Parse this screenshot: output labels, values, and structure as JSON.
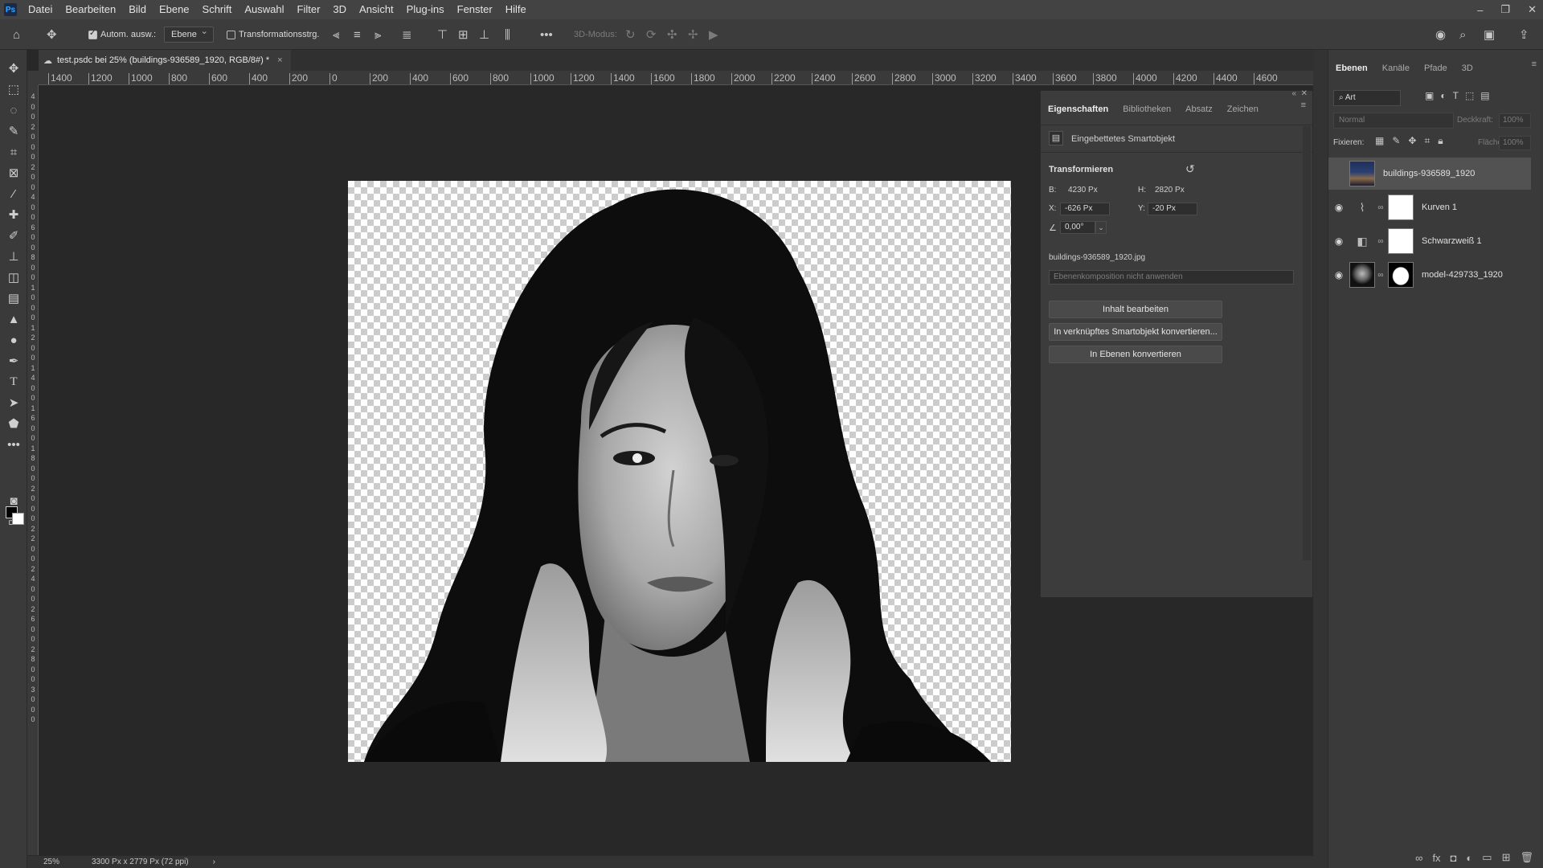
{
  "app": {
    "logo": "Ps"
  },
  "menu": [
    "Datei",
    "Bearbeiten",
    "Bild",
    "Ebene",
    "Schrift",
    "Auswahl",
    "Filter",
    "3D",
    "Ansicht",
    "Plug-ins",
    "Fenster",
    "Hilfe"
  ],
  "window_controls": {
    "minimize": "–",
    "restore": "❐",
    "close": "✕"
  },
  "options": {
    "auto_select_label": "Autom. ausw.:",
    "auto_select_value": "Ebene",
    "transform_label": "Transformationsstrg.",
    "mode_3d_label": "3D-Modus:"
  },
  "document_tab": {
    "title": "test.psdc bei 25% (buildings-936589_1920, RGB/8#) *",
    "close": "×"
  },
  "ruler_top": [
    "1400",
    "1200",
    "1000",
    "800",
    "600",
    "400",
    "200",
    "0",
    "200",
    "400",
    "600",
    "800",
    "1000",
    "1200",
    "1400",
    "1600",
    "1800",
    "2000",
    "2200",
    "2400",
    "2600",
    "2800",
    "3000",
    "3200",
    "3400",
    "3600",
    "3800",
    "4000",
    "4200",
    "4400",
    "4600"
  ],
  "ruler_left": [
    "4",
    "0",
    "0",
    "2",
    "0",
    "0",
    "0",
    "2",
    "0",
    "0",
    "4",
    "0",
    "0",
    "6",
    "0",
    "0",
    "8",
    "0",
    "0",
    "1",
    "0",
    "0",
    "0",
    "1",
    "2",
    "0",
    "0",
    "1",
    "4",
    "0",
    "0",
    "1",
    "6",
    "0",
    "0",
    "1",
    "8",
    "0",
    "0",
    "2",
    "0",
    "0",
    "0",
    "2",
    "2",
    "0",
    "0",
    "2",
    "4",
    "0",
    "0",
    "2",
    "6",
    "0",
    "0",
    "2",
    "8",
    "0",
    "0",
    "3",
    "0",
    "0",
    "0"
  ],
  "properties": {
    "tabs": [
      "Eigenschaften",
      "Bibliotheken",
      "Absatz",
      "Zeichen"
    ],
    "object_type": "Eingebettetes Smartobjekt",
    "section": "Transformieren",
    "b_label": "B:",
    "b_value": "4230 Px",
    "h_label": "H:",
    "h_value": "2820 Px",
    "x_label": "X:",
    "x_value": "-626 Px",
    "y_label": "Y:",
    "y_value": "-20 Px",
    "angle_value": "0,00°",
    "file_name": "buildings-936589_1920.jpg",
    "layer_comp_placeholder": "Ebenenkomposition nicht anwenden",
    "buttons": [
      "Inhalt bearbeiten",
      "In verknüpftes Smartobjekt konvertieren...",
      "In Ebenen konvertieren"
    ]
  },
  "layers_panel": {
    "tabs": [
      "Ebenen",
      "Kanäle",
      "Pfade",
      "3D"
    ],
    "filter_label": "Art",
    "blend_mode": "Normal",
    "opacity_label": "Deckkraft:",
    "opacity_value": "100%",
    "lock_label": "Fixieren:",
    "fill_label": "Fläche:",
    "fill_value": "100%",
    "layers": [
      {
        "name": "buildings-936589_1920",
        "visible": false,
        "selected": true
      },
      {
        "name": "Kurven 1",
        "visible": true,
        "selected": false
      },
      {
        "name": "Schwarzweiß 1",
        "visible": true,
        "selected": false
      },
      {
        "name": "model-429733_1920",
        "visible": true,
        "selected": false
      }
    ],
    "bottom_icons": [
      "link-icon",
      "fx-icon",
      "mask-icon",
      "adjustment-icon",
      "folder-icon",
      "new-layer-icon",
      "trash-icon"
    ]
  },
  "status": {
    "zoom": "25%",
    "doc_size": "3300 Px x 2779 Px (72 ppi)",
    "arrow": "›"
  }
}
